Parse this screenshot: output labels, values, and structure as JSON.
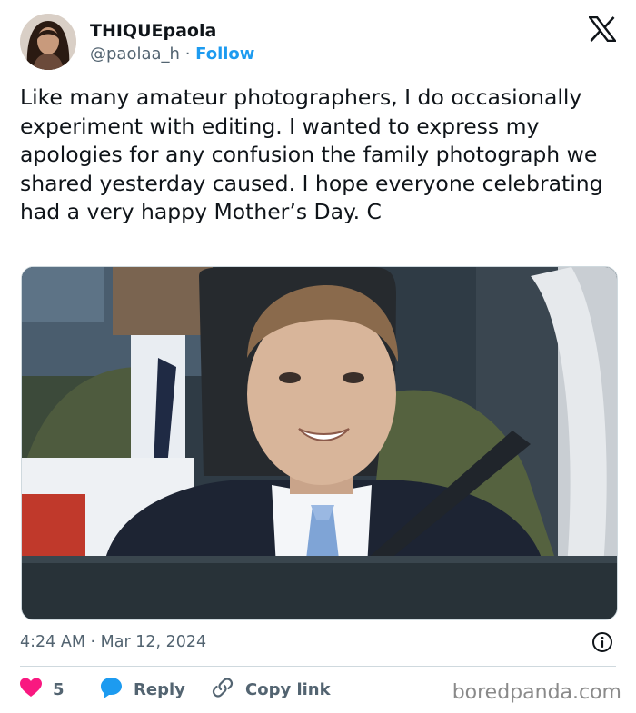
{
  "author": {
    "display_name": "THIQUEpaola",
    "handle": "@paolaa_h",
    "separator": "·",
    "follow_label": "Follow"
  },
  "tweet": {
    "text": "Like many amateur photographers, I do occasionally experiment with editing. I wanted to express my apologies for any confusion the family photograph we shared yesterday caused. I hope everyone celebrating had a very happy Mother’s Day. C"
  },
  "meta": {
    "time": "4:24 AM",
    "separator": "·",
    "date": "Mar 12, 2024"
  },
  "actions": {
    "like_count": "5",
    "reply_label": "Reply",
    "copy_link_label": "Copy link"
  },
  "watermark": "boredpanda.com",
  "colors": {
    "accent": "#1d9bf0",
    "like": "#f91880",
    "secondary_text": "#536471"
  },
  "icons": [
    "x-logo-icon",
    "info-icon",
    "heart-icon",
    "reply-bubble-icon",
    "link-icon"
  ]
}
